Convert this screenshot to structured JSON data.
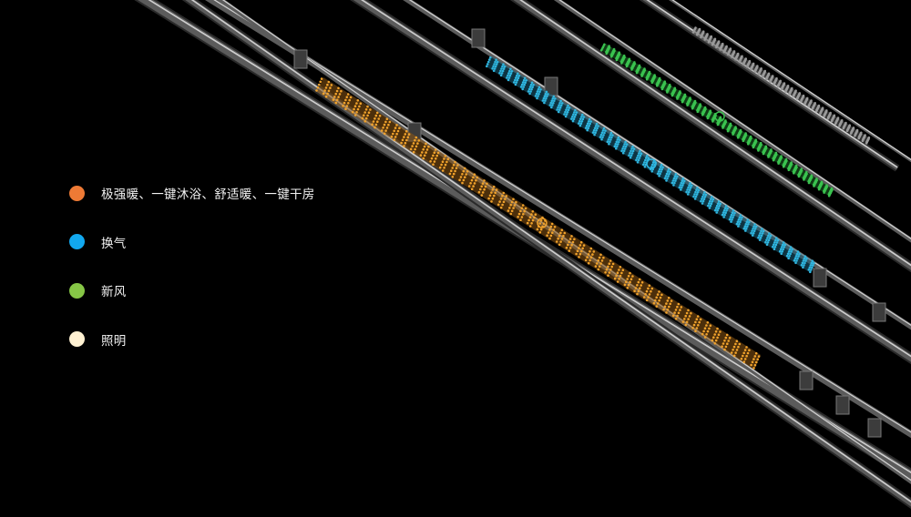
{
  "legend": {
    "items": [
      {
        "label": "极强暖、一键沐浴、舒适暖、一键干房",
        "color": "#ee7a35",
        "icon": "heating-dot-icon"
      },
      {
        "label": "换气",
        "color": "#12a8ef",
        "icon": "ventilation-dot-icon"
      },
      {
        "label": "新风",
        "color": "#86c646",
        "icon": "fresh-air-dot-icon"
      },
      {
        "label": "照明",
        "color": "#fff1d2",
        "icon": "lighting-dot-icon"
      }
    ]
  },
  "modules": {
    "heating": {
      "color": "#f0a22c",
      "glow": "#8a5514"
    },
    "ventilation": {
      "color": "#2fb6e0",
      "glow": "#1a5e78"
    },
    "fresh_air": {
      "color": "#3ac24f",
      "glow": "#1b6a27"
    },
    "lighting": {
      "color": "#9a9a9a",
      "glow": "#555555"
    }
  },
  "rail_color": "#5b5b5b",
  "rail_highlight": "#cfcfcf"
}
